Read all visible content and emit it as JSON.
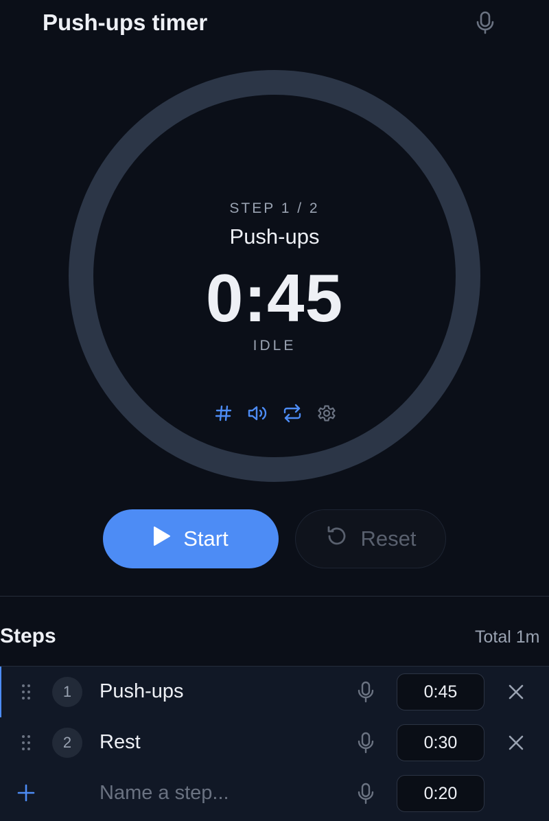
{
  "header": {
    "title": "Push-ups timer",
    "mic_icon": "microphone-icon"
  },
  "timer": {
    "step_label": "STEP 1 / 2",
    "step_name": "Push-ups",
    "time": "0:45",
    "status": "IDLE",
    "progress": 0,
    "icons": [
      "hash-icon",
      "volume-icon",
      "repeat-icon",
      "gear-icon"
    ],
    "colors": {
      "accent": "#4d8cf5",
      "ring": "#2c3647",
      "background": "#0b0f18"
    }
  },
  "controls": {
    "start_label": "Start",
    "reset_label": "Reset",
    "start_icon": "play-icon",
    "reset_icon": "reset-icon"
  },
  "steps": {
    "title": "Steps",
    "total": "Total 1m",
    "items": [
      {
        "index": "1",
        "name": "Push-ups",
        "duration": "0:45",
        "active": true
      },
      {
        "index": "2",
        "name": "Rest",
        "duration": "0:30",
        "active": false
      }
    ],
    "new_step": {
      "placeholder": "Name a step...",
      "duration": "0:20"
    }
  }
}
